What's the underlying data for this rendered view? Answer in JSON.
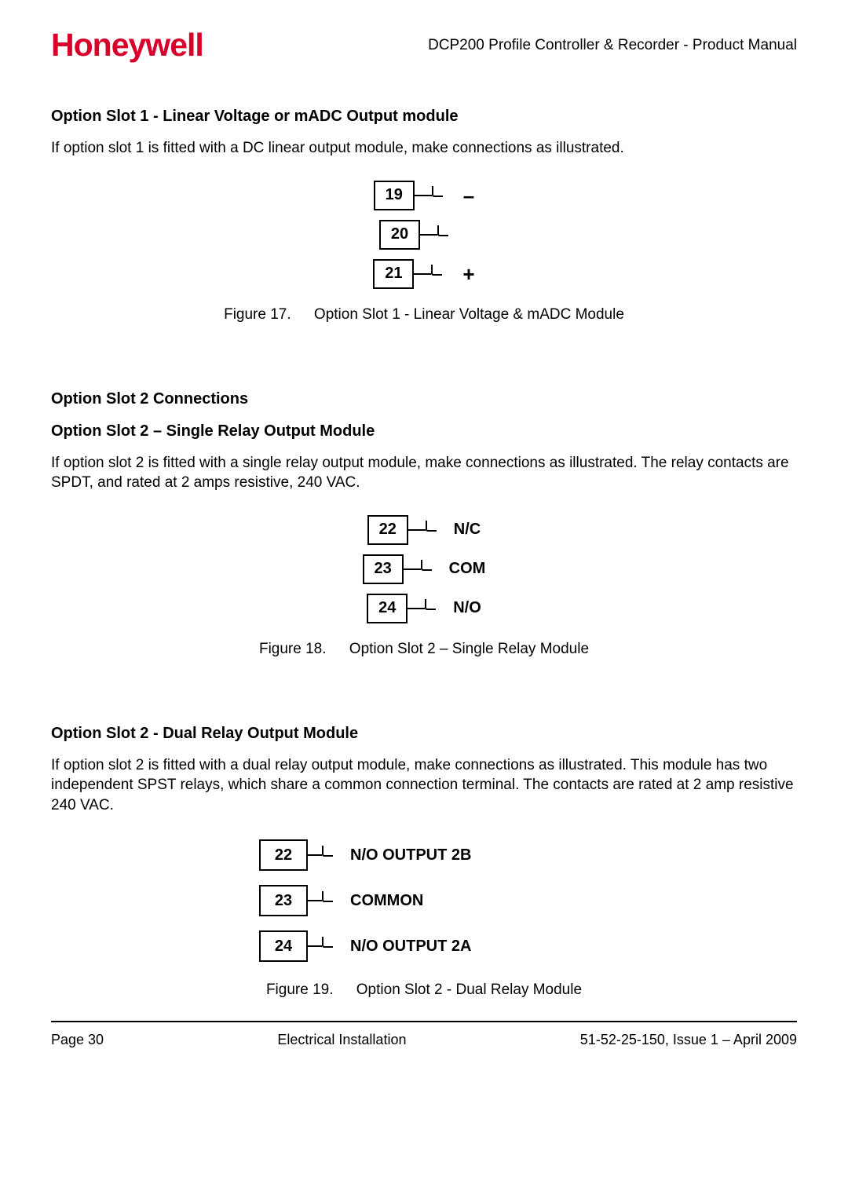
{
  "header": {
    "logo_text": "Honeywell",
    "doc_title": "DCP200 Profile Controller & Recorder - Product Manual"
  },
  "sections": {
    "s1": {
      "heading": "Option Slot 1 - Linear Voltage or mADC Output module",
      "body": "If option slot 1 is fitted with a DC linear output module, make connections as illustrated.",
      "fig_no": "Figure 17.",
      "fig_title": "Option Slot 1 - Linear Voltage & mADC Module",
      "terms": [
        {
          "num": "19",
          "label": "–"
        },
        {
          "num": "20",
          "label": ""
        },
        {
          "num": "21",
          "label": "+"
        }
      ]
    },
    "s2": {
      "group_heading": "Option Slot 2 Connections",
      "heading": "Option Slot 2 – Single Relay Output Module",
      "body": "If option slot 2 is fitted with a single relay output module, make connections as illustrated. The relay contacts are SPDT, and rated at 2 amps resistive, 240 VAC.",
      "fig_no": "Figure 18.",
      "fig_title": "Option Slot 2 – Single Relay Module",
      "terms": [
        {
          "num": "22",
          "label": "N/C"
        },
        {
          "num": "23",
          "label": "COM"
        },
        {
          "num": "24",
          "label": "N/O"
        }
      ]
    },
    "s3": {
      "heading": "Option Slot 2 - Dual Relay Output Module",
      "body": "If option slot 2 is fitted with a dual relay output module, make connections as illustrated. This module has two independent SPST relays, which share a common connection terminal. The contacts are rated at 2 amp resistive 240 VAC.",
      "fig_no": "Figure 19.",
      "fig_title": "Option Slot 2 - Dual Relay Module",
      "terms": [
        {
          "num": "22",
          "label": "N/O OUTPUT 2B"
        },
        {
          "num": "23",
          "label": "COMMON"
        },
        {
          "num": "24",
          "label": "N/O OUTPUT 2A"
        }
      ]
    }
  },
  "footer": {
    "page_num": "Page 30",
    "section": "Electrical Installation",
    "doc_ref": "51-52-25-150, Issue 1 – April 2009"
  }
}
